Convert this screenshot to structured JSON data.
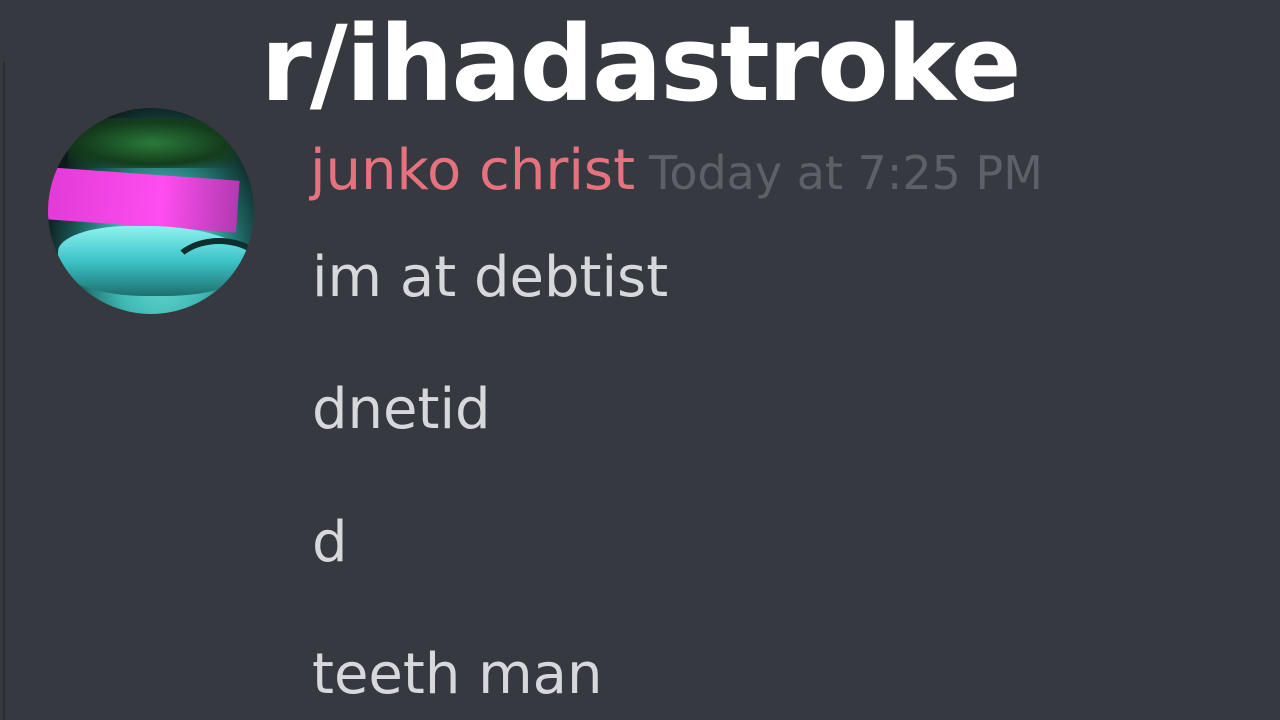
{
  "overlay": {
    "title": "r/ihadastroke"
  },
  "message": {
    "username": "junko christ",
    "timestamp": "Today at 7:25 PM",
    "username_color": "#e7727f",
    "lines": [
      "im at debtist",
      "dnetid",
      "d",
      "teeth man"
    ]
  },
  "colors": {
    "background": "#36393f",
    "message_text": "#d6d8db",
    "timestamp": "#5d6066",
    "overlay_text": "#ffffff"
  },
  "icons": {
    "avatar": "user-avatar-image"
  }
}
